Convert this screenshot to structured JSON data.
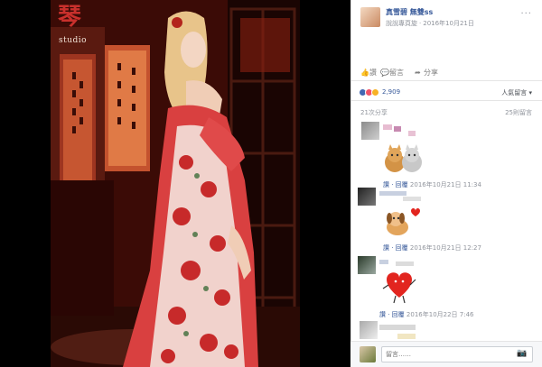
{
  "photo": {
    "watermark_glyph": "琴",
    "watermark_studio": "studio"
  },
  "post": {
    "author_name": "真雪碧 無雙ss",
    "meta_prefix": "說說專頁旋",
    "meta_date": "2016年10月21日"
  },
  "actions": {
    "like_label": "讚",
    "comment_label": "留言",
    "share_label": "分享"
  },
  "reactions": {
    "count": "2,909",
    "sort_label": "人氣留言"
  },
  "stats": {
    "shares": "21次分享",
    "comments": "25則留言"
  },
  "comments": [
    {
      "meta_action": "讚 · 回覆",
      "meta_time": "2016年10月21日 11:34"
    },
    {
      "meta_action": "讚 · 回覆",
      "meta_time": "2016年10月21日 12:27"
    },
    {
      "meta_action": "讚 · 回覆",
      "meta_time": "2016年10月22日 7:46"
    }
  ],
  "composer": {
    "placeholder": "留言……"
  },
  "colors": {
    "link": "#365899",
    "muted": "#90949c",
    "like": "#4267b2",
    "love": "#f25268",
    "haha": "#f7b125"
  }
}
